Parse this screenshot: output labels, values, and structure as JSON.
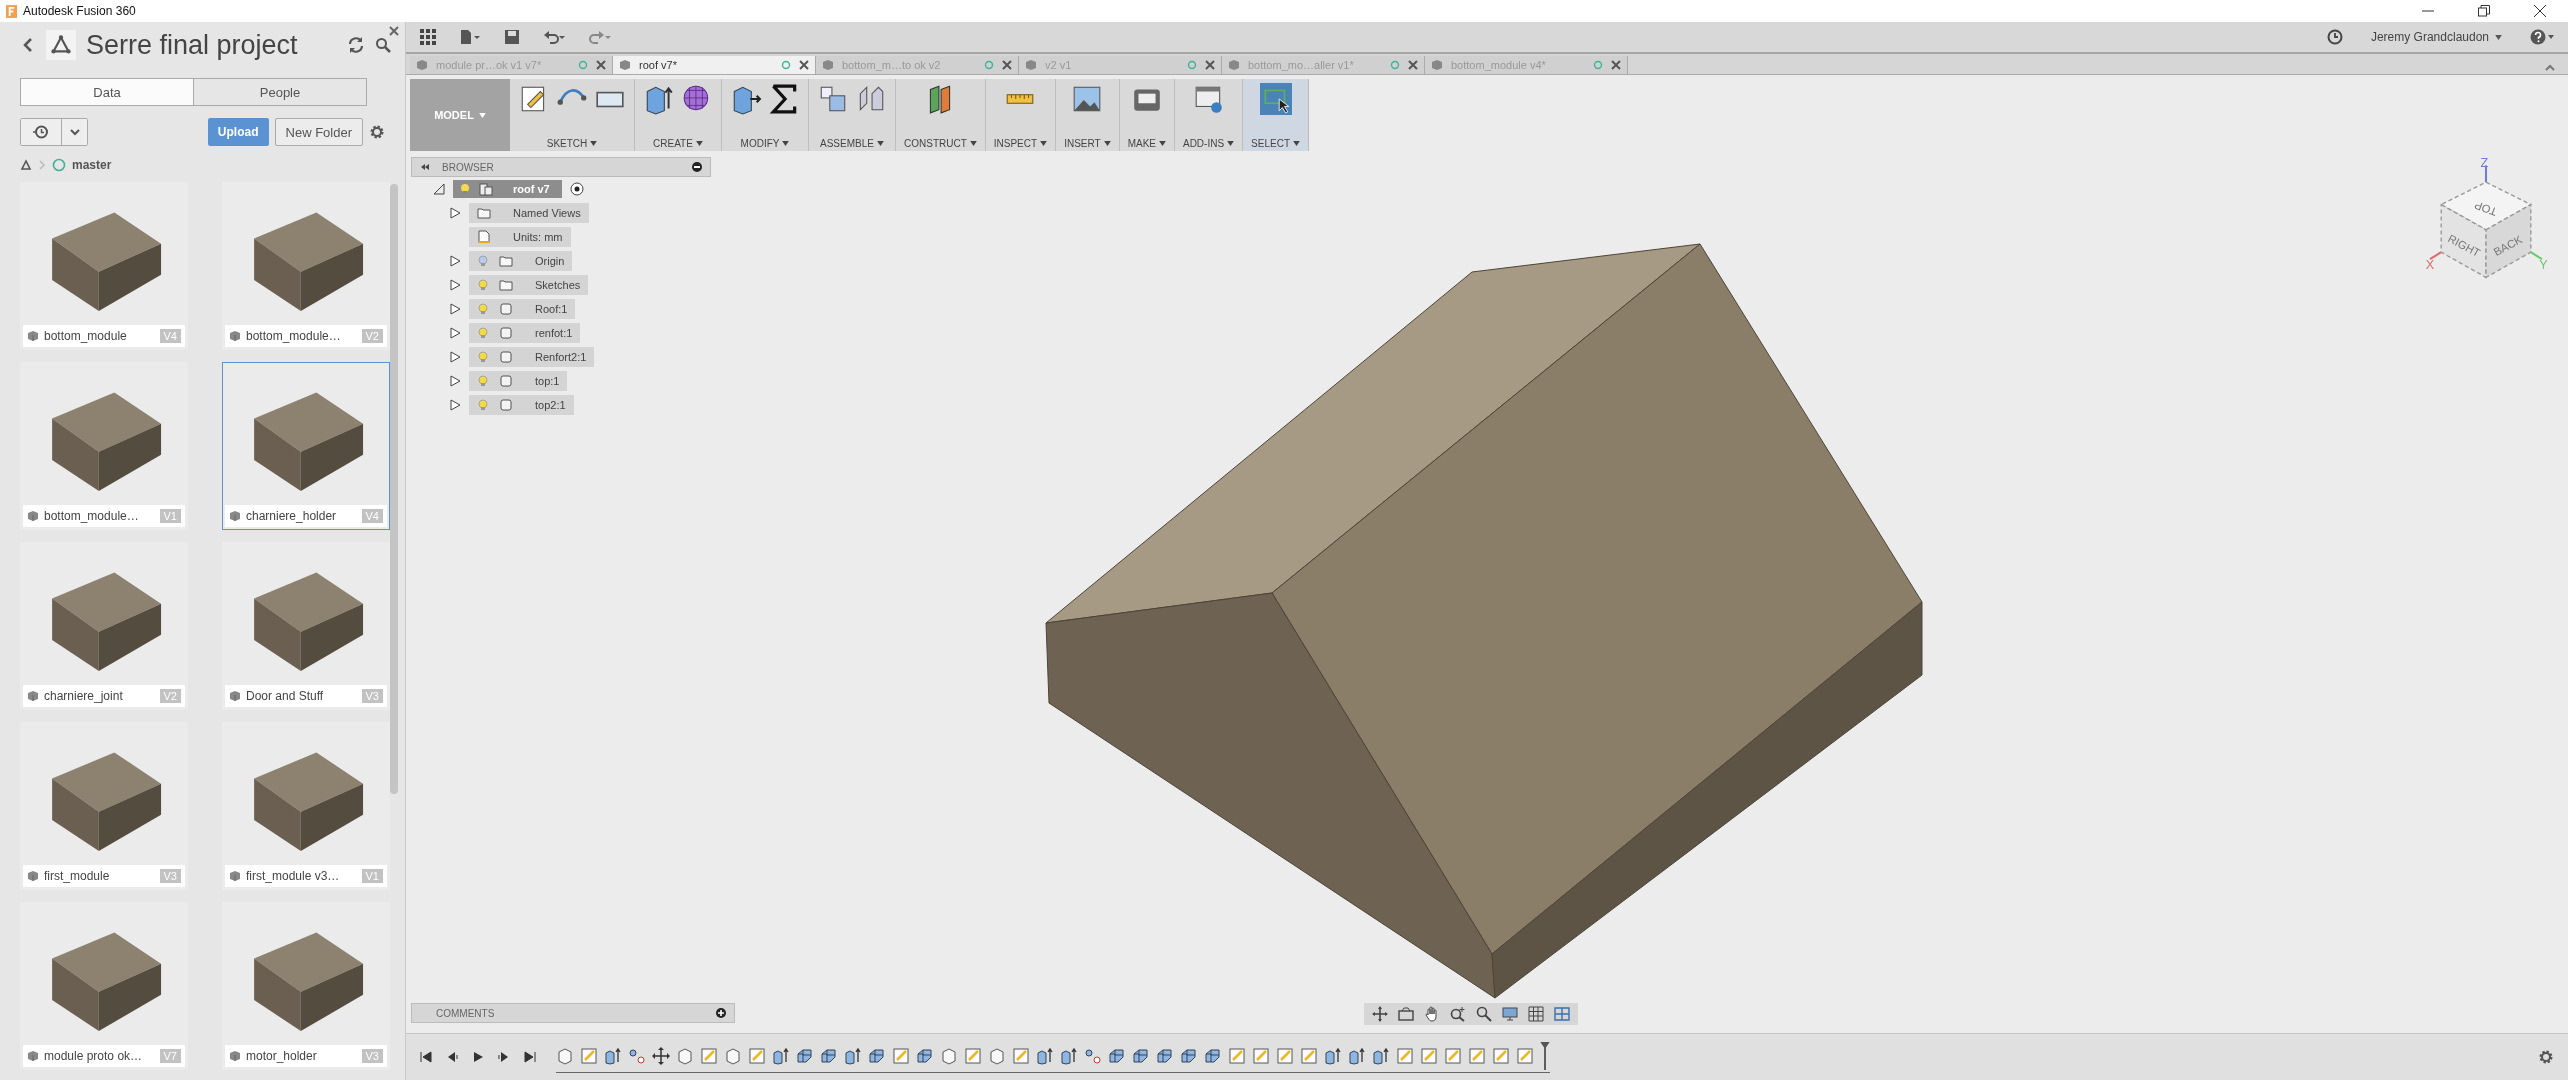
{
  "window": {
    "title": "Autodesk Fusion 360"
  },
  "data_panel": {
    "title": "Serre final project",
    "tabs": [
      {
        "label": "Data",
        "selected": true
      },
      {
        "label": "People",
        "selected": false
      }
    ],
    "upload": "Upload",
    "new_folder": "New Folder",
    "breadcrumb": "master",
    "items": [
      {
        "name": "bottom_module",
        "version": "V4",
        "selected": false
      },
      {
        "name": "bottom_module…",
        "version": "V2",
        "selected": false
      },
      {
        "name": "bottom_module…",
        "version": "V1",
        "selected": false
      },
      {
        "name": "charniere_holder",
        "version": "V4",
        "selected": true
      },
      {
        "name": "charniere_joint",
        "version": "V2",
        "selected": false
      },
      {
        "name": "Door and Stuff",
        "version": "V3",
        "selected": false
      },
      {
        "name": "first_module",
        "version": "V3",
        "selected": false
      },
      {
        "name": "first_module v3…",
        "version": "V1",
        "selected": false
      },
      {
        "name": "module proto ok…",
        "version": "V7",
        "selected": false
      },
      {
        "name": "motor_holder",
        "version": "V3",
        "selected": false
      }
    ]
  },
  "top_bar": {
    "user": "Jeremy Grandclaudon"
  },
  "doc_tabs": [
    {
      "label": "module pr…ok v1 v7*",
      "selected": false
    },
    {
      "label": "roof v7*",
      "selected": true
    },
    {
      "label": "bottom_m…to ok v2",
      "selected": false
    },
    {
      "label": "v2 v1",
      "selected": false
    },
    {
      "label": "bottom_mo…aller v1*",
      "selected": false
    },
    {
      "label": "bottom_module v4*",
      "selected": false
    }
  ],
  "toolbar": {
    "mode": "MODEL",
    "groups": [
      {
        "label": "SKETCH",
        "selected": false
      },
      {
        "label": "CREATE",
        "selected": false
      },
      {
        "label": "MODIFY",
        "selected": false
      },
      {
        "label": "ASSEMBLE",
        "selected": false
      },
      {
        "label": "CONSTRUCT",
        "selected": false
      },
      {
        "label": "INSPECT",
        "selected": false
      },
      {
        "label": "INSERT",
        "selected": false
      },
      {
        "label": "MAKE",
        "selected": false
      },
      {
        "label": "ADD-INS",
        "selected": false
      },
      {
        "label": "SELECT",
        "selected": true
      }
    ]
  },
  "browser": {
    "title": "BROWSER",
    "root": "roof v7",
    "items": [
      {
        "name": "Named Views",
        "kind": "folder",
        "expandable": true
      },
      {
        "name": "Units: mm",
        "kind": "units",
        "expandable": false
      },
      {
        "name": "Origin",
        "kind": "folder",
        "expandable": true,
        "visible": false
      },
      {
        "name": "Sketches",
        "kind": "folder",
        "expandable": true,
        "visible": true
      },
      {
        "name": "Roof:1",
        "kind": "component",
        "expandable": true,
        "visible": true
      },
      {
        "name": "renfot:1",
        "kind": "component",
        "expandable": true,
        "visible": true
      },
      {
        "name": "Renfort2:1",
        "kind": "component",
        "expandable": true,
        "visible": true
      },
      {
        "name": "top:1",
        "kind": "component",
        "expandable": true,
        "visible": true
      },
      {
        "name": "top2:1",
        "kind": "component",
        "expandable": true,
        "visible": true
      }
    ]
  },
  "viewcube": {
    "top": "TOP",
    "right": "RIGHT",
    "back": "BACK",
    "x": "X",
    "y": "Y",
    "z": "Z"
  },
  "comments": {
    "title": "COMMENTS"
  },
  "timeline": {
    "steps": [
      {
        "kind": "body"
      },
      {
        "kind": "sketch"
      },
      {
        "kind": "extrude"
      },
      {
        "kind": "joint"
      },
      {
        "kind": "move"
      },
      {
        "kind": "body"
      },
      {
        "kind": "sketch"
      },
      {
        "kind": "body"
      },
      {
        "kind": "sketch"
      },
      {
        "kind": "extrude"
      },
      {
        "kind": "combine"
      },
      {
        "kind": "combine"
      },
      {
        "kind": "extrude"
      },
      {
        "kind": "combine"
      },
      {
        "kind": "sketch"
      },
      {
        "kind": "combine"
      },
      {
        "kind": "body"
      },
      {
        "kind": "sketch"
      },
      {
        "kind": "body"
      },
      {
        "kind": "sketch"
      },
      {
        "kind": "extrude"
      },
      {
        "kind": "extrude"
      },
      {
        "kind": "joint"
      },
      {
        "kind": "combine"
      },
      {
        "kind": "combine"
      },
      {
        "kind": "combine"
      },
      {
        "kind": "combine"
      },
      {
        "kind": "combine"
      },
      {
        "kind": "sketch"
      },
      {
        "kind": "sketch"
      },
      {
        "kind": "sketch"
      },
      {
        "kind": "sketch"
      },
      {
        "kind": "extrude"
      },
      {
        "kind": "extrude"
      },
      {
        "kind": "extrude"
      },
      {
        "kind": "sketch"
      },
      {
        "kind": "sketch"
      },
      {
        "kind": "sketch"
      },
      {
        "kind": "sketch"
      },
      {
        "kind": "sketch"
      },
      {
        "kind": "sketch"
      }
    ]
  }
}
